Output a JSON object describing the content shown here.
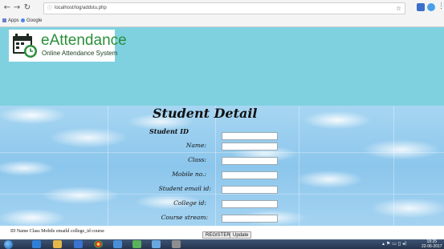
{
  "browser": {
    "url": "localhost/log/addstu.php",
    "bookmarks": [
      {
        "label": "Apps"
      },
      {
        "label": "Google"
      }
    ]
  },
  "logo": {
    "title": "eAttendance",
    "subtitle": "Online Attendance System"
  },
  "form": {
    "title": "Student Detail",
    "id_label": "Student ID",
    "fields": [
      {
        "label": "Name:",
        "value": ""
      },
      {
        "label": "Class:",
        "value": ""
      },
      {
        "label": "Mobile no.:",
        "value": ""
      },
      {
        "label": "Student email id:",
        "value": ""
      },
      {
        "label": "College id:",
        "value": ""
      },
      {
        "label": "Course stream:",
        "value": ""
      }
    ]
  },
  "footer": {
    "columns_text": "ID Name Class Mobile emaild college_id course",
    "register_label": "REGISTER",
    "update_label": "Update"
  },
  "taskbar": {
    "time": "18:25",
    "date": "22-06-2017"
  },
  "colors": {
    "header_band": "#7fd1e0",
    "logo_green": "#2a8f3a",
    "taskbar": "#2f4463"
  }
}
